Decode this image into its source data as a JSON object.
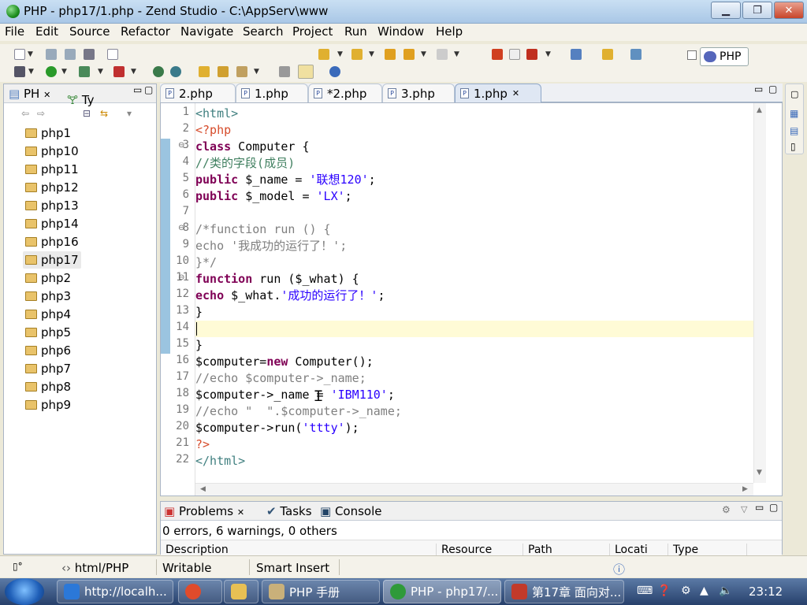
{
  "window": {
    "title": "PHP - php17/1.php - Zend Studio - C:\\AppServ\\www",
    "minimize_label": "▁",
    "maximize_label": "❐",
    "close_label": "✕"
  },
  "menu": [
    "File",
    "Edit",
    "Source",
    "Refactor",
    "Navigate",
    "Search",
    "Project",
    "Run",
    "Window",
    "Help"
  ],
  "perspective": {
    "label": "PHP"
  },
  "explorer": {
    "tabs": [
      {
        "label": "PH"
      },
      {
        "label": "Ty"
      }
    ],
    "items": [
      {
        "label": "php1"
      },
      {
        "label": "php10"
      },
      {
        "label": "php11"
      },
      {
        "label": "php12"
      },
      {
        "label": "php13"
      },
      {
        "label": "php14"
      },
      {
        "label": "php16"
      },
      {
        "label": "php17",
        "selected": true
      },
      {
        "label": "php2"
      },
      {
        "label": "php3"
      },
      {
        "label": "php4"
      },
      {
        "label": "php5"
      },
      {
        "label": "php6"
      },
      {
        "label": "php7"
      },
      {
        "label": "php8"
      },
      {
        "label": "php9"
      }
    ]
  },
  "editor": {
    "tabs": [
      {
        "label": "2.php"
      },
      {
        "label": "1.php"
      },
      {
        "label": "*2.php"
      },
      {
        "label": "3.php"
      },
      {
        "label": "1.php",
        "active": true
      }
    ],
    "lines": [
      {
        "n": "1",
        "text": "<html>"
      },
      {
        "n": "2",
        "text": "<?php"
      },
      {
        "n": "3",
        "kw": "class",
        "text": " Computer {"
      },
      {
        "n": "4",
        "text": "//类的字段(成员)"
      },
      {
        "n": "5",
        "kw": "public",
        "text": " $_name = ",
        "str": "'联想120'",
        "tail": ";"
      },
      {
        "n": "6",
        "kw": "public",
        "text": " $_model = ",
        "str": "'LX'",
        "tail": ";"
      },
      {
        "n": "7",
        "text": ""
      },
      {
        "n": "8",
        "text": "/*function run () {"
      },
      {
        "n": "9",
        "text": "echo '我成功的运行了！';"
      },
      {
        "n": "10",
        "text": "}*/"
      },
      {
        "n": "11",
        "kw": "function",
        "text": " run ($_what) {"
      },
      {
        "n": "12",
        "kw": "echo",
        "text": " $_what.",
        "str": "'成功的运行了！'",
        "tail": ";"
      },
      {
        "n": "13",
        "text": "}"
      },
      {
        "n": "14",
        "text": ""
      },
      {
        "n": "15",
        "text": "}"
      },
      {
        "n": "16",
        "pre": "$computer=",
        "kw": "new",
        "text": " Computer();"
      },
      {
        "n": "17",
        "text": "//echo $computer->_name;"
      },
      {
        "n": "18",
        "text": "$computer->_name = ",
        "str": "'IBM110'",
        "tail": ";"
      },
      {
        "n": "19",
        "text": "//echo \"  \".$computer->_name;"
      },
      {
        "n": "20",
        "text": "$computer->run(",
        "str": "'ttty'",
        "tail": ");"
      },
      {
        "n": "21",
        "text": "?>"
      },
      {
        "n": "22",
        "text": "</html>"
      }
    ]
  },
  "problems": {
    "tabs": [
      {
        "label": "Problems"
      },
      {
        "label": "Tasks"
      },
      {
        "label": "Console"
      }
    ],
    "summary": "0 errors, 6 warnings, 0 others",
    "columns": [
      "Description",
      "Resource",
      "Path",
      "Locati",
      "Type"
    ]
  },
  "status": {
    "file_type": "html/PHP",
    "writable": "Writable",
    "insert_mode": "Smart Insert"
  },
  "taskbar": {
    "items": [
      {
        "label": "http://localh...",
        "color": "#2b78d8"
      },
      {
        "label": "",
        "color": "#e04b2b"
      },
      {
        "label": "",
        "color": "#e8c054"
      },
      {
        "label": "PHP 手册",
        "color": "#c9b07a"
      },
      {
        "label": "PHP - php17/...",
        "color": "#2f9a3a",
        "active": true
      },
      {
        "label": "第17章 面向对...",
        "color": "#c23a2a"
      }
    ],
    "clock": "23:12"
  }
}
